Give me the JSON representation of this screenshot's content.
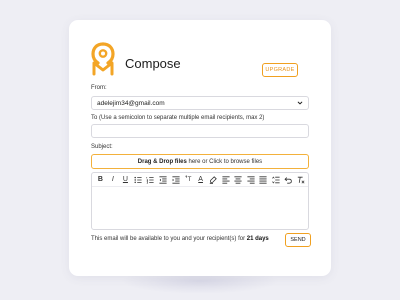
{
  "header": {
    "title": "Compose",
    "upgrade_label": "UPGRADE"
  },
  "form": {
    "from_label": "From:",
    "from_value": "adelejim34@gmail.com",
    "to_label": "To  (Use a semicolon to separate multiple email recipients, max 2)",
    "to_value": "",
    "subject_label": "Subject:",
    "dropzone_bold": "Drag & Drop files",
    "dropzone_rest": " here or Click to browse files"
  },
  "toolbar": {
    "bold": "B",
    "italic": "I",
    "underline": "U",
    "font_size": "ꜛT",
    "font_color": "A"
  },
  "footer": {
    "text_prefix": "This email will be available to you and your recipient(s) for ",
    "days": "21 days",
    "send_label": "SEND"
  },
  "colors": {
    "accent": "#f3a526",
    "border": "#d9d9df",
    "background": "#eeeef4"
  }
}
